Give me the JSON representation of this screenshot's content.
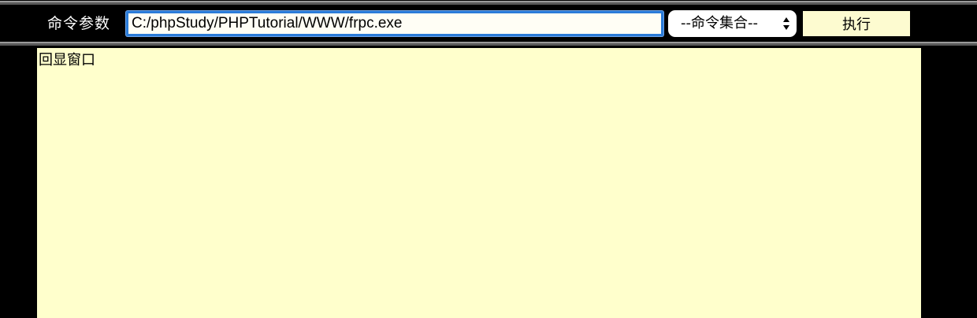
{
  "toolbar": {
    "command_label": "命令参数",
    "command_input_value": "C:/phpStudy/PHPTutorial/WWW/frpc.exe",
    "command_select_value": "--命令集合--",
    "execute_button_label": "执行"
  },
  "output": {
    "placeholder_text": "回显窗口"
  },
  "colors": {
    "background": "#000000",
    "input_focus_border": "#2a7bd8",
    "output_background": "#ffffcc",
    "button_background": "#fdfbd0"
  },
  "icons": {
    "select_arrows": "up-down-chevron-icon"
  }
}
